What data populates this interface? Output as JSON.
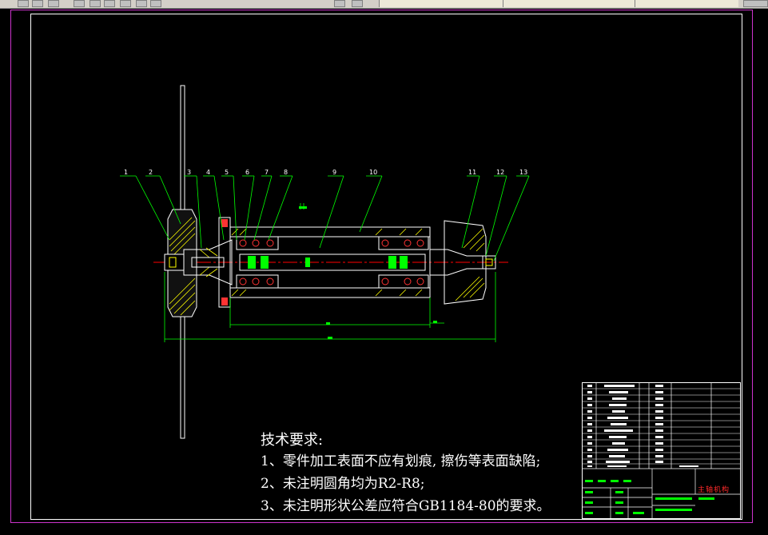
{
  "toolbar": {
    "tabs": [
      "",
      "",
      ""
    ]
  },
  "balloons": [
    "1",
    "2",
    "3",
    "4",
    "5",
    "6",
    "7",
    "8",
    "9",
    "10",
    "11",
    "12",
    "13"
  ],
  "notes": {
    "title": "技术要求:",
    "lines": [
      "1、零件加工表面不应有划痕, 擦伤等表面缺陷;",
      "2、未注明圆角均为R2-R8;",
      "3、未注明形状公差应符合GB1184-80的要求。"
    ]
  },
  "title_block": {
    "name": "主轴机构"
  },
  "colors": {
    "background": "#000000",
    "outline": "#ffffff",
    "dimension": "#00ff00",
    "hatch": "#ffff00",
    "centerline": "#ff0000",
    "sheet_border": "#cc33cc",
    "bearing_ball": "#ff3333"
  }
}
